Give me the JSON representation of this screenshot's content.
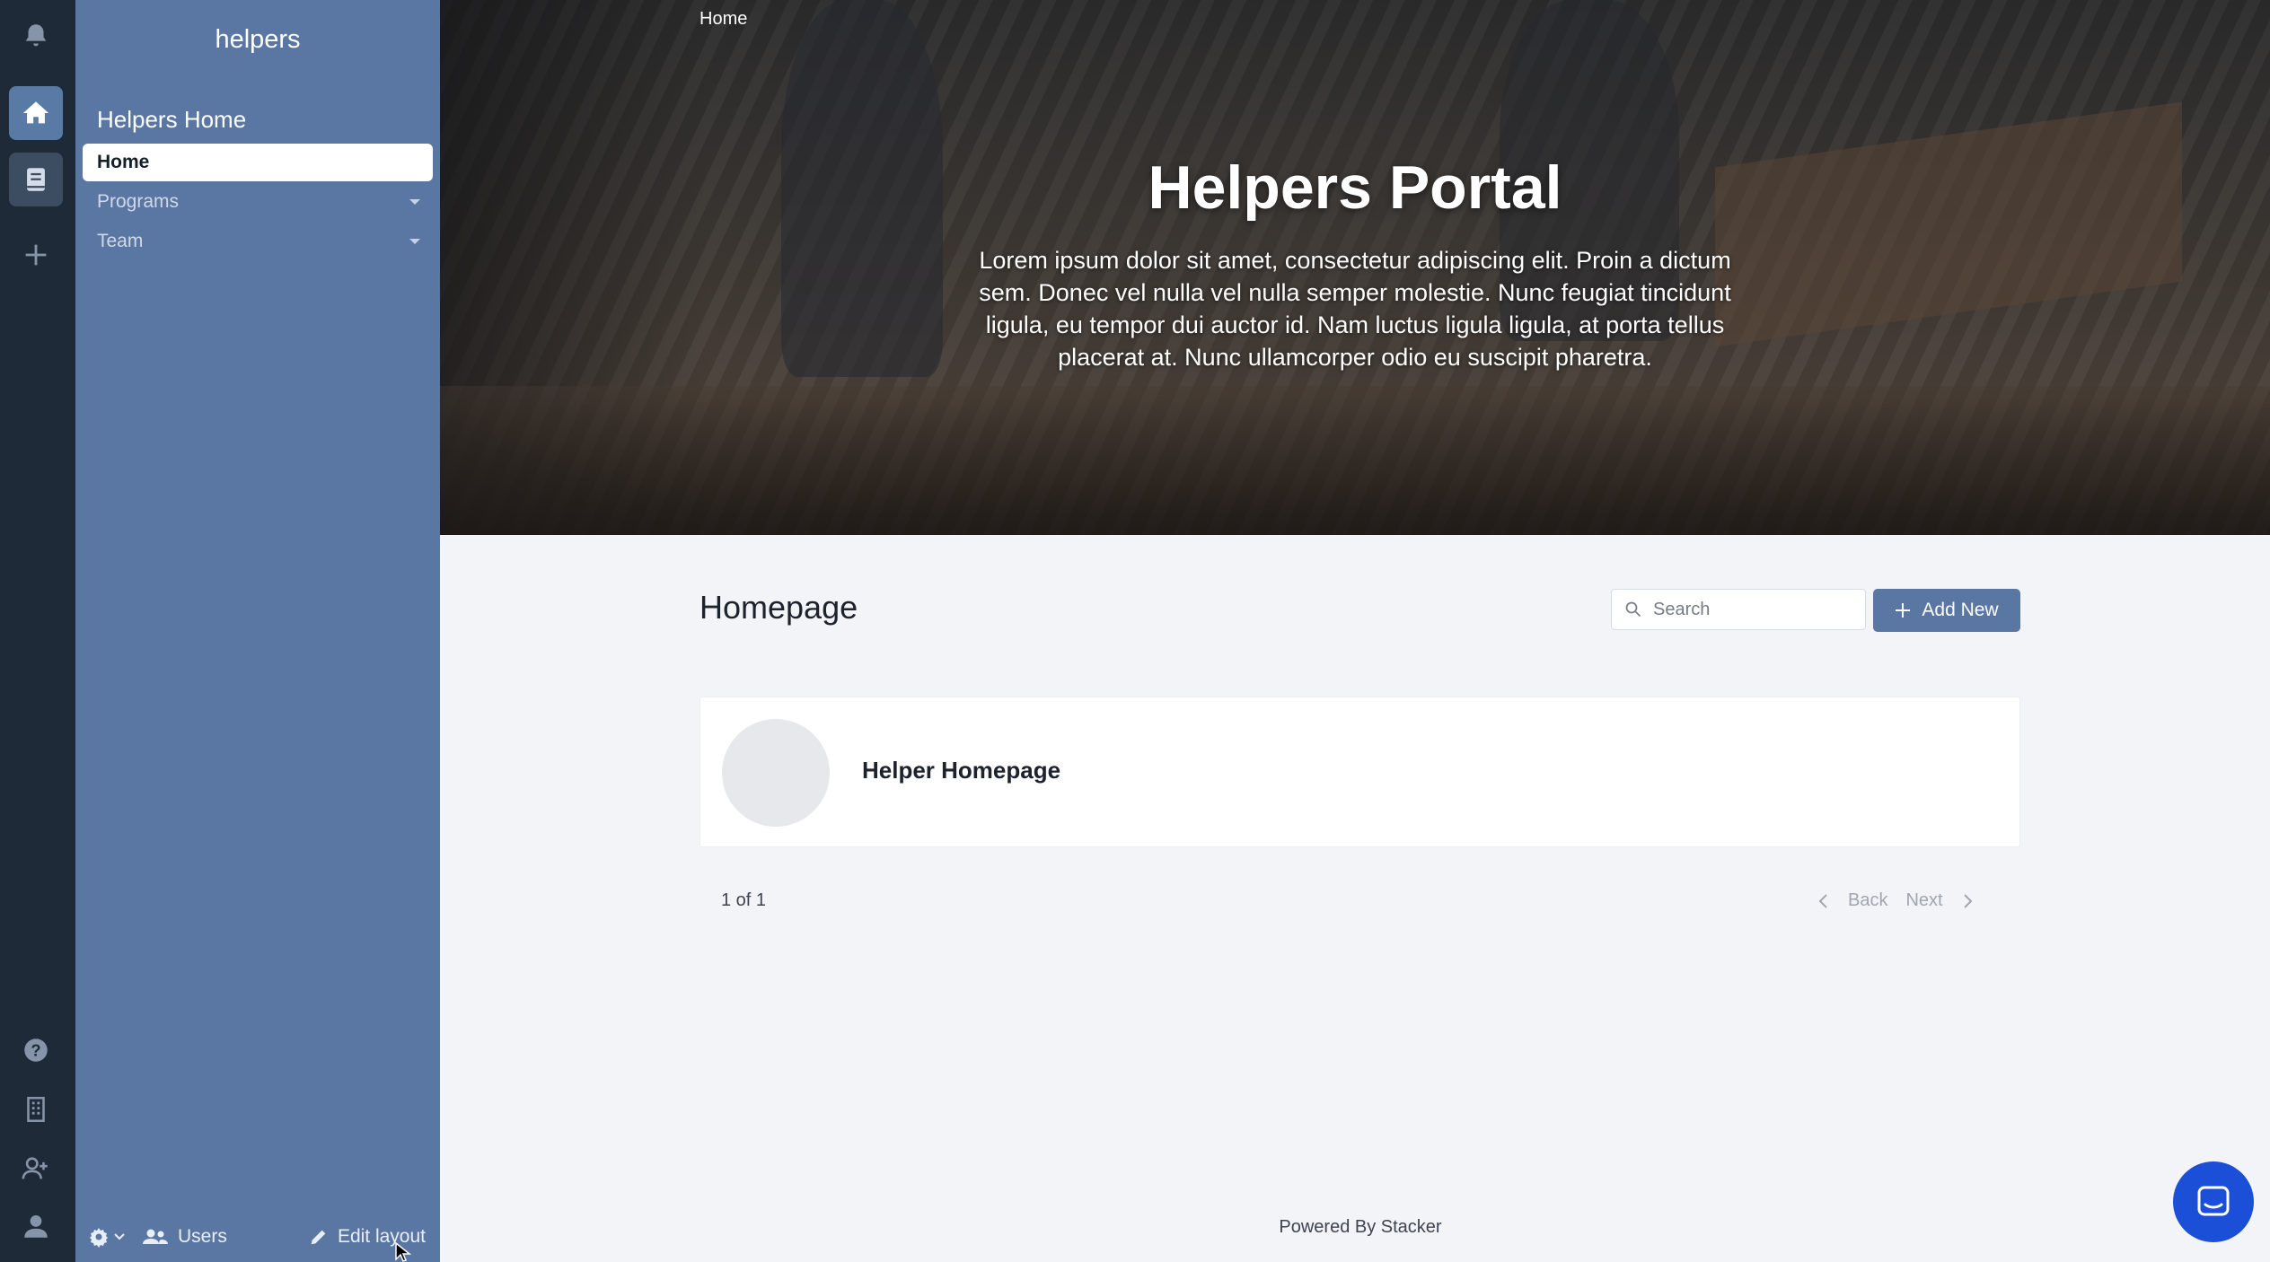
{
  "app": {
    "name": "helpers"
  },
  "sidebar": {
    "heading": "Helpers Home",
    "items": [
      {
        "label": "Home",
        "active": true
      },
      {
        "label": "Programs",
        "has_submenu": true
      },
      {
        "label": "Team",
        "has_submenu": true
      }
    ],
    "footer": {
      "users_label": "Users",
      "edit_label": "Edit layout"
    }
  },
  "rail": {
    "icons": [
      "bell-icon",
      "home-icon",
      "book-icon",
      "plus-icon",
      "help-icon",
      "building-icon",
      "add-user-icon",
      "user-icon"
    ]
  },
  "hero": {
    "breadcrumb": "Home",
    "title": "Helpers Portal",
    "body": "Lorem ipsum dolor sit amet, consectetur adipiscing elit. Proin a dictum sem. Donec vel nulla vel nulla semper molestie. Nunc feugiat tincidunt ligula, eu tempor dui auctor id. Nam luctus ligula ligula, at porta tellus placerat at. Nunc ullamcorper odio eu suscipit pharetra."
  },
  "main": {
    "title": "Homepage",
    "search": {
      "placeholder": "Search",
      "value": ""
    },
    "add_button": "Add New",
    "records": [
      {
        "title": "Helper Homepage"
      }
    ],
    "pagination": {
      "count": "1 of 1",
      "back": "Back",
      "next": "Next"
    }
  },
  "footer": {
    "powered_by": "Powered By Stacker"
  },
  "colors": {
    "rail_bg": "#1e2a37",
    "sidebar_bg": "#5a77a3",
    "accent": "#5a77a3",
    "chat_button": "#1b4fd8",
    "page_bg": "#f3f4f7"
  }
}
